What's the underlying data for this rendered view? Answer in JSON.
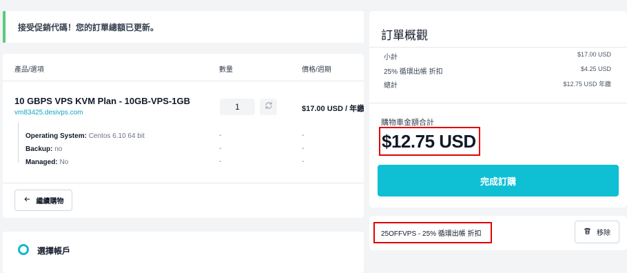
{
  "alert": {
    "message": "接受促銷代碼！您的訂單總額已更新。",
    "accent_color": "#5cc97b"
  },
  "cart_table": {
    "headers": {
      "product": "產品/選項",
      "quantity": "數量",
      "price": "價格/週期"
    },
    "item": {
      "name": "10 GBPS VPS KVM Plan - 10GB-VPS-1GB",
      "domain": "vm83425.desivps.com",
      "quantity": "1",
      "price_cycle": "$17.00 USD / 年繳",
      "options": [
        {
          "label": "Operating System:",
          "value": "Centos 6.10 64 bit",
          "qty": "-",
          "price": "-"
        },
        {
          "label": "Backup:",
          "value": "no",
          "qty": "-",
          "price": "-"
        },
        {
          "label": "Managed:",
          "value": "No",
          "qty": "-",
          "price": "-"
        }
      ]
    },
    "continue_label": "繼續購物"
  },
  "account": {
    "title": "選擇帳戶"
  },
  "summary": {
    "title": "訂單概觀",
    "rows": [
      {
        "label": "小計",
        "amount": "$17.00 USD"
      },
      {
        "label": "25% 循環出帳 折扣",
        "amount": "$4.25 USD"
      },
      {
        "label": "總計",
        "amount": "$12.75 USD 年繳"
      }
    ],
    "cart_total_label": "購物車金額合計",
    "cart_total_value": "$12.75 USD",
    "checkout_label": "完成訂購",
    "accent_color": "#0fbfd4",
    "highlight_color": "#e10000"
  },
  "promo": {
    "code_text": "25OFFVPS - 25% 循環出帳 折扣",
    "remove_label": "移除"
  },
  "icons": {
    "refresh": "refresh-icon",
    "back_arrow": "arrow-left-icon",
    "trash": "trash-icon",
    "radio": "radio-ring-icon"
  }
}
